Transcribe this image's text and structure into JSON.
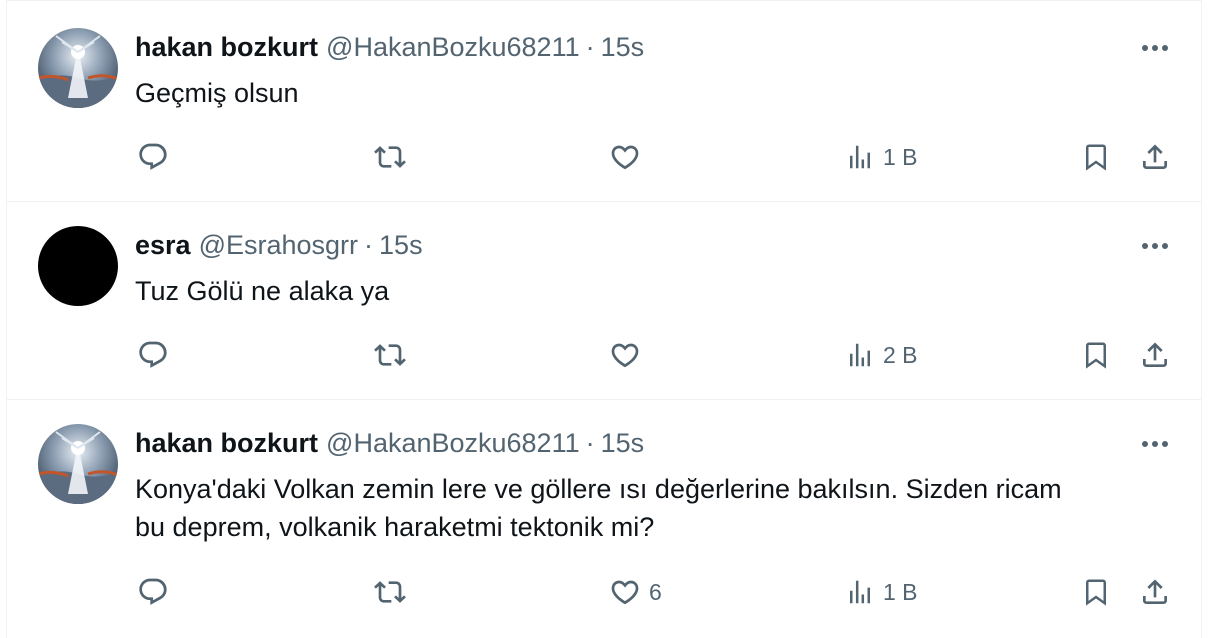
{
  "colors": {
    "text": "#0f1419",
    "muted": "#536471",
    "border": "#eff3f4",
    "icon": "#536471"
  },
  "tweets": [
    {
      "name": "hakan bozkurt",
      "handle": "@HakanBozku68211",
      "time": "15s",
      "text": "Geçmiş olsun",
      "avatar": "mystic-figure-avatar",
      "replies": "",
      "retweets": "",
      "likes": "",
      "views": "1 B"
    },
    {
      "name": "esra",
      "handle": "@Esrahosgrr",
      "time": "15s",
      "text": "Tuz Gölü ne alaka ya",
      "avatar": "black-avatar",
      "replies": "",
      "retweets": "",
      "likes": "",
      "views": "2 B"
    },
    {
      "name": "hakan bozkurt",
      "handle": "@HakanBozku68211",
      "time": "15s",
      "text": "Konya'daki Volkan zemin lere ve göllere ısı değerlerine bakılsın. Sizden ricam bu deprem, volkanik haraketmi tektonik mi?",
      "avatar": "mystic-figure-avatar",
      "replies": "",
      "retweets": "",
      "likes": "6",
      "views": "1 B"
    }
  ],
  "separator": "·"
}
